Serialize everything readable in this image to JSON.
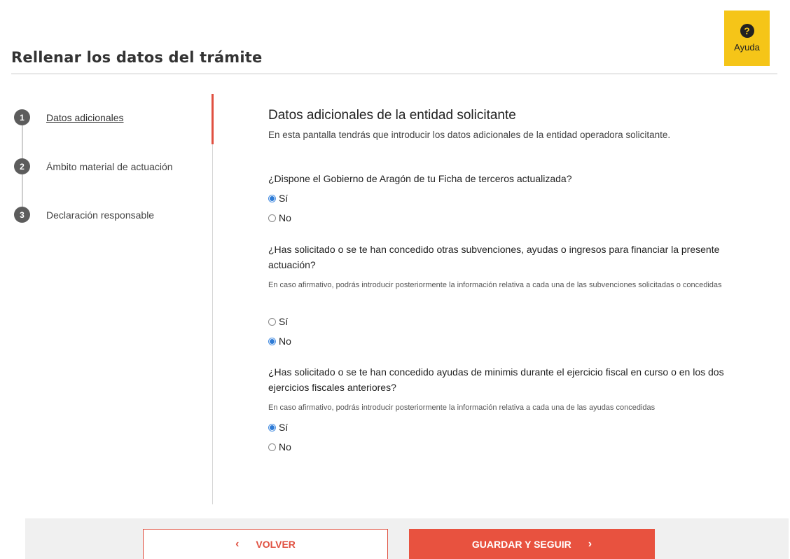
{
  "header": {
    "title": "Rellenar los datos del trámite",
    "help_label": "Ayuda",
    "help_icon": "question-circle-icon"
  },
  "colors": {
    "accent": "#e8523f",
    "help_bg": "#f5c518",
    "radio_checked": "#2e7bd6"
  },
  "steps": [
    {
      "number": "1",
      "label": "Datos adicionales",
      "active": true
    },
    {
      "number": "2",
      "label": "Ámbito material de actuación",
      "active": false
    },
    {
      "number": "3",
      "label": "Declaración responsable",
      "active": false
    }
  ],
  "section": {
    "title": "Datos adicionales de la entidad solicitante",
    "description": "En esta pantalla tendrás que introducir los datos adicionales de la entidad operadora solicitante."
  },
  "questions": [
    {
      "text": "¿Dispone el Gobierno de Aragón de tu Ficha de terceros actualizada?",
      "hint": "",
      "options": [
        {
          "label": "Sí",
          "checked": true
        },
        {
          "label": "No",
          "checked": false
        }
      ]
    },
    {
      "text": "¿Has solicitado o se te han concedido otras subvenciones, ayudas o ingresos para financiar la presente actuación?",
      "hint": "En caso afirmativo, podrás introducir posteriormente la información relativa a cada una de las subvenciones solicitadas o concedidas",
      "options": [
        {
          "label": "Sí",
          "checked": false
        },
        {
          "label": "No",
          "checked": true
        }
      ]
    },
    {
      "text": "¿Has solicitado o se te han concedido ayudas de minimis durante el ejercicio fiscal en curso o en los dos ejercicios fiscales anteriores?",
      "hint": "En caso afirmativo, podrás introducir posteriormente la información relativa a cada una de las ayudas concedidas",
      "options": [
        {
          "label": "Sí",
          "checked": true
        },
        {
          "label": "No",
          "checked": false
        }
      ]
    }
  ],
  "footer": {
    "back_label": "VOLVER",
    "next_label": "GUARDAR Y SEGUIR",
    "back_icon": "chevron-left-icon",
    "next_icon": "chevron-right-icon"
  }
}
